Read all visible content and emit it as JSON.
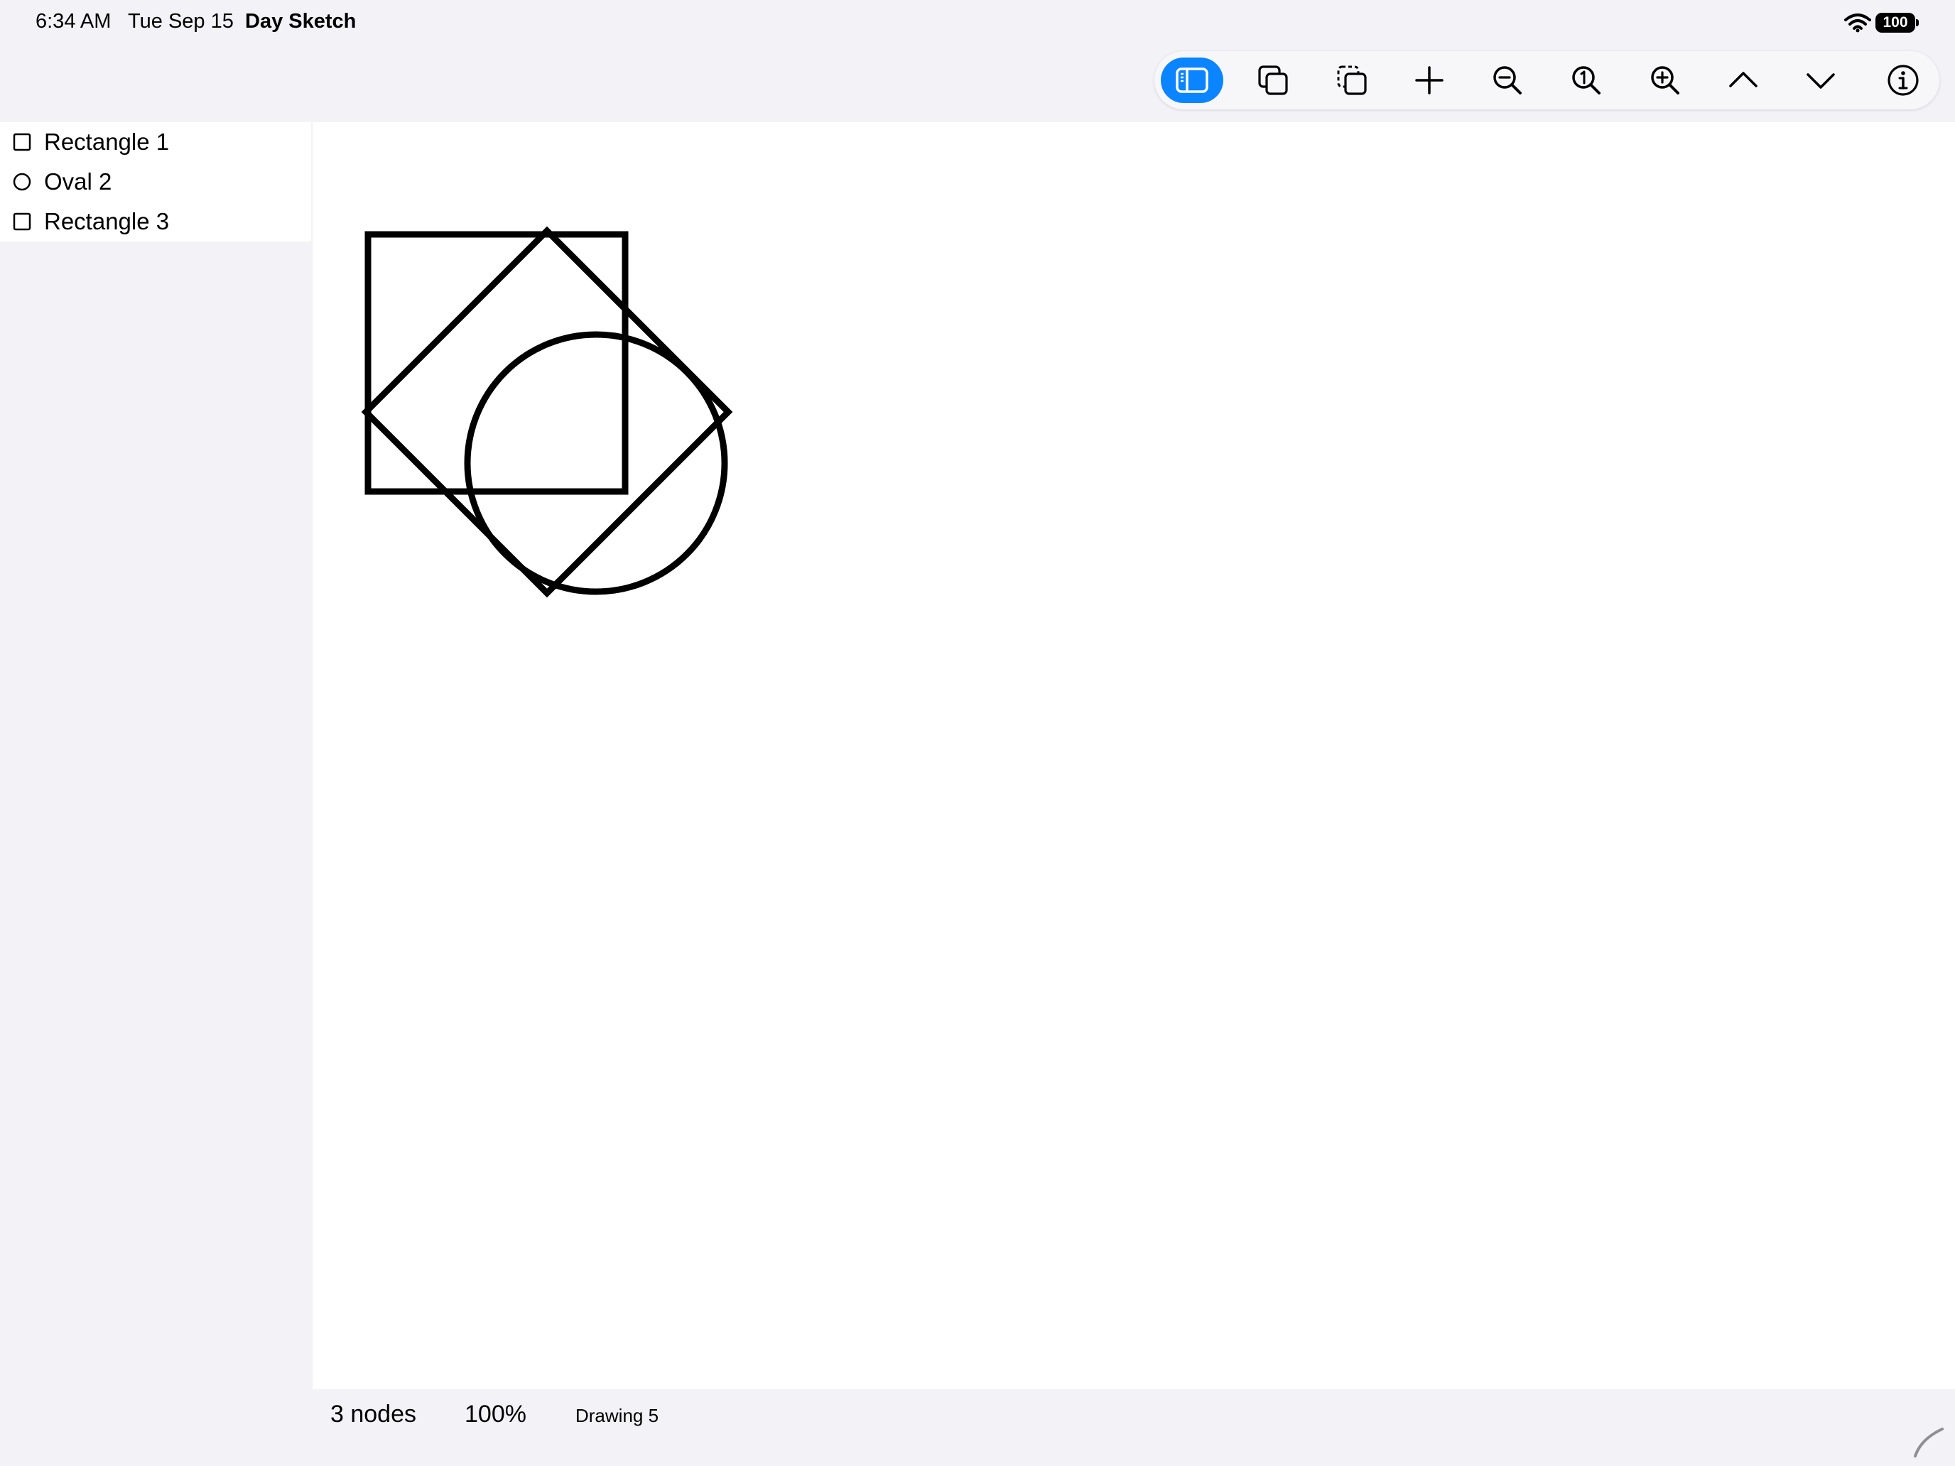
{
  "status_bar": {
    "time": "6:34 AM",
    "date": "Tue Sep 15",
    "app_name": "Day Sketch",
    "battery_percent": "100"
  },
  "toolbar": {
    "buttons": [
      {
        "icon": "sidebar-toggle-icon",
        "active": true
      },
      {
        "icon": "duplicate-icon",
        "active": false
      },
      {
        "icon": "paste-copy-icon",
        "active": false
      },
      {
        "icon": "plus-icon",
        "active": false
      },
      {
        "icon": "zoom-out-icon",
        "active": false
      },
      {
        "icon": "zoom-actual-size-icon",
        "active": false
      },
      {
        "icon": "zoom-in-icon",
        "active": false
      },
      {
        "icon": "chevron-up-icon",
        "active": false
      },
      {
        "icon": "chevron-down-icon",
        "active": false
      },
      {
        "icon": "info-icon",
        "active": false
      }
    ],
    "accent_color": "#0a84ff"
  },
  "layers": {
    "items": [
      {
        "label": "Rectangle 1",
        "shape": "rectangle"
      },
      {
        "label": "Oval 2",
        "shape": "oval"
      },
      {
        "label": "Rectangle 3",
        "shape": "rectangle"
      }
    ]
  },
  "canvas": {
    "shapes": [
      {
        "name": "Rectangle 1",
        "type": "rectangle",
        "rotation_deg": 0
      },
      {
        "name": "Oval 2",
        "type": "oval",
        "rotation_deg": 0
      },
      {
        "name": "Rectangle 3",
        "type": "rectangle",
        "rotation_deg": 45
      }
    ],
    "stroke_color": "#000000"
  },
  "footer": {
    "node_count": "3 nodes",
    "zoom": "100%",
    "document_name": "Drawing 5"
  }
}
